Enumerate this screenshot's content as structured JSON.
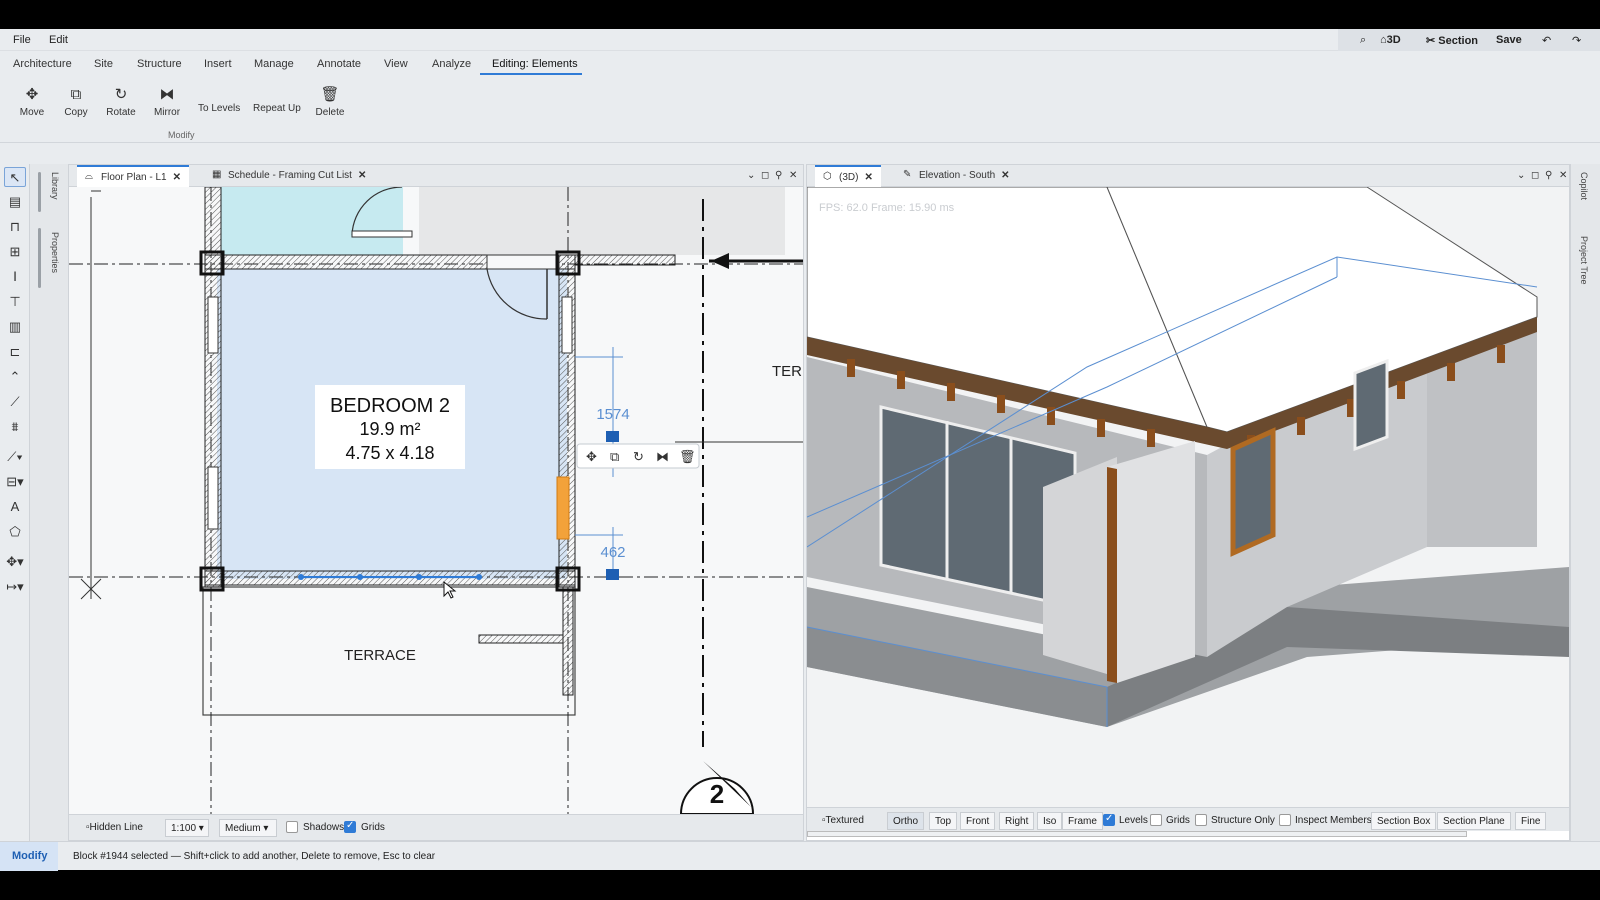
{
  "menu": {
    "file": "File",
    "edit": "Edit"
  },
  "quick": {
    "view3d": "3D",
    "section": "Section",
    "save": "Save"
  },
  "tabs": [
    "Architecture",
    "Site",
    "Structure",
    "Insert",
    "Manage",
    "Annotate",
    "View",
    "Analyze",
    "Editing: Elements"
  ],
  "ribbon": {
    "tools": [
      {
        "label": "Move",
        "icon": "move-icon"
      },
      {
        "label": "Copy",
        "icon": "copy-icon"
      },
      {
        "label": "Rotate",
        "icon": "rotate-icon"
      },
      {
        "label": "Mirror",
        "icon": "mirror-icon"
      }
    ],
    "to_levels": "To Levels",
    "repeat_up": "Repeat Up",
    "delete": "Delete",
    "group_label": "Modify"
  },
  "side_tabs": {
    "library": "Library",
    "properties": "Properties"
  },
  "right_tabs": {
    "copilot": "Copilot",
    "project_tree": "Project Tree"
  },
  "left_panel": {
    "tabs": [
      {
        "label": "Floor Plan - L1",
        "active": true
      },
      {
        "label": "Schedule - Framing Cut List",
        "active": false
      }
    ],
    "room": {
      "name": "BEDROOM 2",
      "area": "19.9 m²",
      "dims": "4.75 x 4.18"
    },
    "terrace": "TERRACE",
    "terrace_cut": "TER",
    "dim1": "1574",
    "dim2": "462",
    "grid_bubble": "2",
    "viewbar": {
      "style": "Hidden Line",
      "scale": "1:100",
      "detail": "Medium",
      "shadows": "Shadows",
      "grids": "Grids"
    }
  },
  "right_panel": {
    "tabs": [
      {
        "label": "(3D)",
        "active": true
      },
      {
        "label": "Elevation - South",
        "active": false
      }
    ],
    "fps_overlay": "FPS: 62.0  Frame: 15.90 ms",
    "viewbar": {
      "textured": "Textured",
      "ortho": "Ortho",
      "top": "Top",
      "front": "Front",
      "right": "Right",
      "iso": "Iso",
      "frame": "Frame",
      "levels": "Levels",
      "grids": "Grids",
      "structure_only": "Structure Only",
      "inspect_members": "Inspect Members",
      "section_box": "Section Box",
      "section_plane": "Section Plane",
      "fine": "Fine"
    }
  },
  "status": {
    "mode": "Modify",
    "message": "Block #1944 selected — Shift+click to add another, Delete to remove, Esc to clear"
  }
}
